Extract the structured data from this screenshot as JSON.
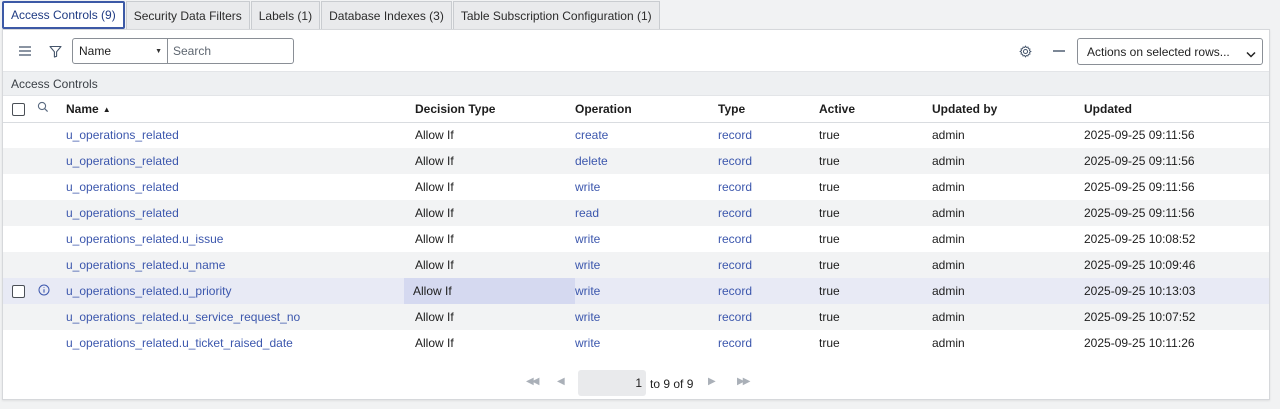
{
  "tabs": [
    {
      "label": "Access Controls (9)",
      "active": true
    },
    {
      "label": "Security Data Filters"
    },
    {
      "label": "Labels (1)"
    },
    {
      "label": "Database Indexes (3)"
    },
    {
      "label": "Table Subscription Configuration (1)"
    }
  ],
  "toolbar": {
    "field_select": "Name",
    "search_placeholder": "Search",
    "actions_label": "Actions on selected rows..."
  },
  "list_title": "Access Controls",
  "columns": {
    "name": "Name",
    "decision_type": "Decision Type",
    "operation": "Operation",
    "type": "Type",
    "active": "Active",
    "updated_by": "Updated by",
    "updated": "Updated"
  },
  "rows": [
    {
      "name": "u_operations_related",
      "decision_type": "Allow If",
      "operation": "create",
      "type": "record",
      "active": "true",
      "updated_by": "admin",
      "updated": "2025-09-25 09:11:56"
    },
    {
      "name": "u_operations_related",
      "decision_type": "Allow If",
      "operation": "delete",
      "type": "record",
      "active": "true",
      "updated_by": "admin",
      "updated": "2025-09-25 09:11:56"
    },
    {
      "name": "u_operations_related",
      "decision_type": "Allow If",
      "operation": "write",
      "type": "record",
      "active": "true",
      "updated_by": "admin",
      "updated": "2025-09-25 09:11:56"
    },
    {
      "name": "u_operations_related",
      "decision_type": "Allow If",
      "operation": "read",
      "type": "record",
      "active": "true",
      "updated_by": "admin",
      "updated": "2025-09-25 09:11:56"
    },
    {
      "name": "u_operations_related.u_issue",
      "decision_type": "Allow If",
      "operation": "write",
      "type": "record",
      "active": "true",
      "updated_by": "admin",
      "updated": "2025-09-25 10:08:52"
    },
    {
      "name": "u_operations_related.u_name",
      "decision_type": "Allow If",
      "operation": "write",
      "type": "record",
      "active": "true",
      "updated_by": "admin",
      "updated": "2025-09-25 10:09:46"
    },
    {
      "name": "u_operations_related.u_priority",
      "decision_type": "Allow If",
      "operation": "write",
      "type": "record",
      "active": "true",
      "updated_by": "admin",
      "updated": "2025-09-25 10:13:03"
    },
    {
      "name": "u_operations_related.u_service_request_no",
      "decision_type": "Allow If",
      "operation": "write",
      "type": "record",
      "active": "true",
      "updated_by": "admin",
      "updated": "2025-09-25 10:07:52"
    },
    {
      "name": "u_operations_related.u_ticket_raised_date",
      "decision_type": "Allow If",
      "operation": "write",
      "type": "record",
      "active": "true",
      "updated_by": "admin",
      "updated": "2025-09-25 10:11:26"
    }
  ],
  "pagination": {
    "current": "1",
    "range_text": "to 9 of 9"
  },
  "icons": {
    "menu": "hamburger-menu-icon",
    "filter": "filter-funnel-icon",
    "settings": "gear-icon",
    "collapse": "minus-icon",
    "column_search": "search-icon",
    "row_preview": "info-icon",
    "first": "first-page-icon",
    "prev": "previous-page-icon",
    "next": "next-page-icon",
    "last": "last-page-icon"
  },
  "colors": {
    "link": "#3c57ad",
    "active_tab_border": "#3c59a6",
    "row_hover": "#e8eaf5"
  }
}
